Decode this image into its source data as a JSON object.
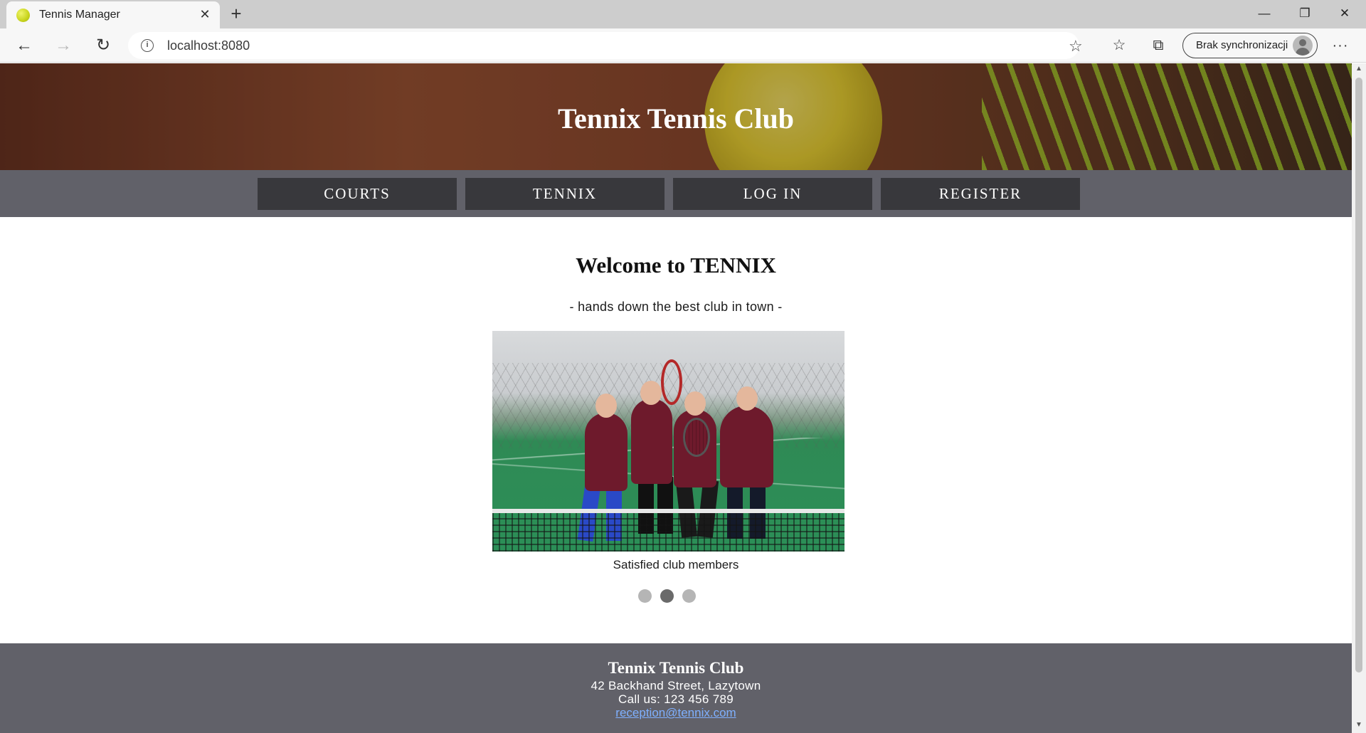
{
  "browser": {
    "tab_title": "Tennis Manager",
    "tab_close": "✕",
    "new_tab": "+",
    "window_min": "—",
    "window_max": "❐",
    "window_close": "✕",
    "back": "←",
    "forward": "→",
    "reload": "↻",
    "url": "localhost:8080",
    "info_glyph": "i",
    "add_favorite_glyph": "☆",
    "favorites_glyph": "☆",
    "collections_glyph": "⧉",
    "sync_label": "Brak synchronizacji",
    "more_glyph": "···",
    "scroll_up": "▲",
    "scroll_down": "▼",
    "icons": [
      "info-icon",
      "star-add-icon",
      "favorites-icon",
      "collections-icon",
      "profile-icon",
      "more-icon"
    ]
  },
  "header": {
    "title": "Tennix Tennis Club"
  },
  "nav": {
    "items": [
      {
        "label": "COURTS"
      },
      {
        "label": "TENNIX"
      },
      {
        "label": "LOG IN"
      },
      {
        "label": "REGISTER"
      }
    ]
  },
  "main": {
    "heading": "Welcome to TENNIX",
    "tagline": "- hands down the best club in town -",
    "carousel": {
      "caption": "Satisfied club members",
      "slide_count": 3,
      "active_index": 2
    }
  },
  "footer": {
    "title": "Tennix Tennis Club",
    "address": "42 Backhand Street, Lazytown",
    "phone": "Call us: 123 456 789",
    "email": "reception@tennix.com"
  },
  "colors": {
    "nav_background": "#616169",
    "nav_item_background": "#38383c",
    "footer_background": "#616169",
    "link_color": "#7fb0ff"
  }
}
